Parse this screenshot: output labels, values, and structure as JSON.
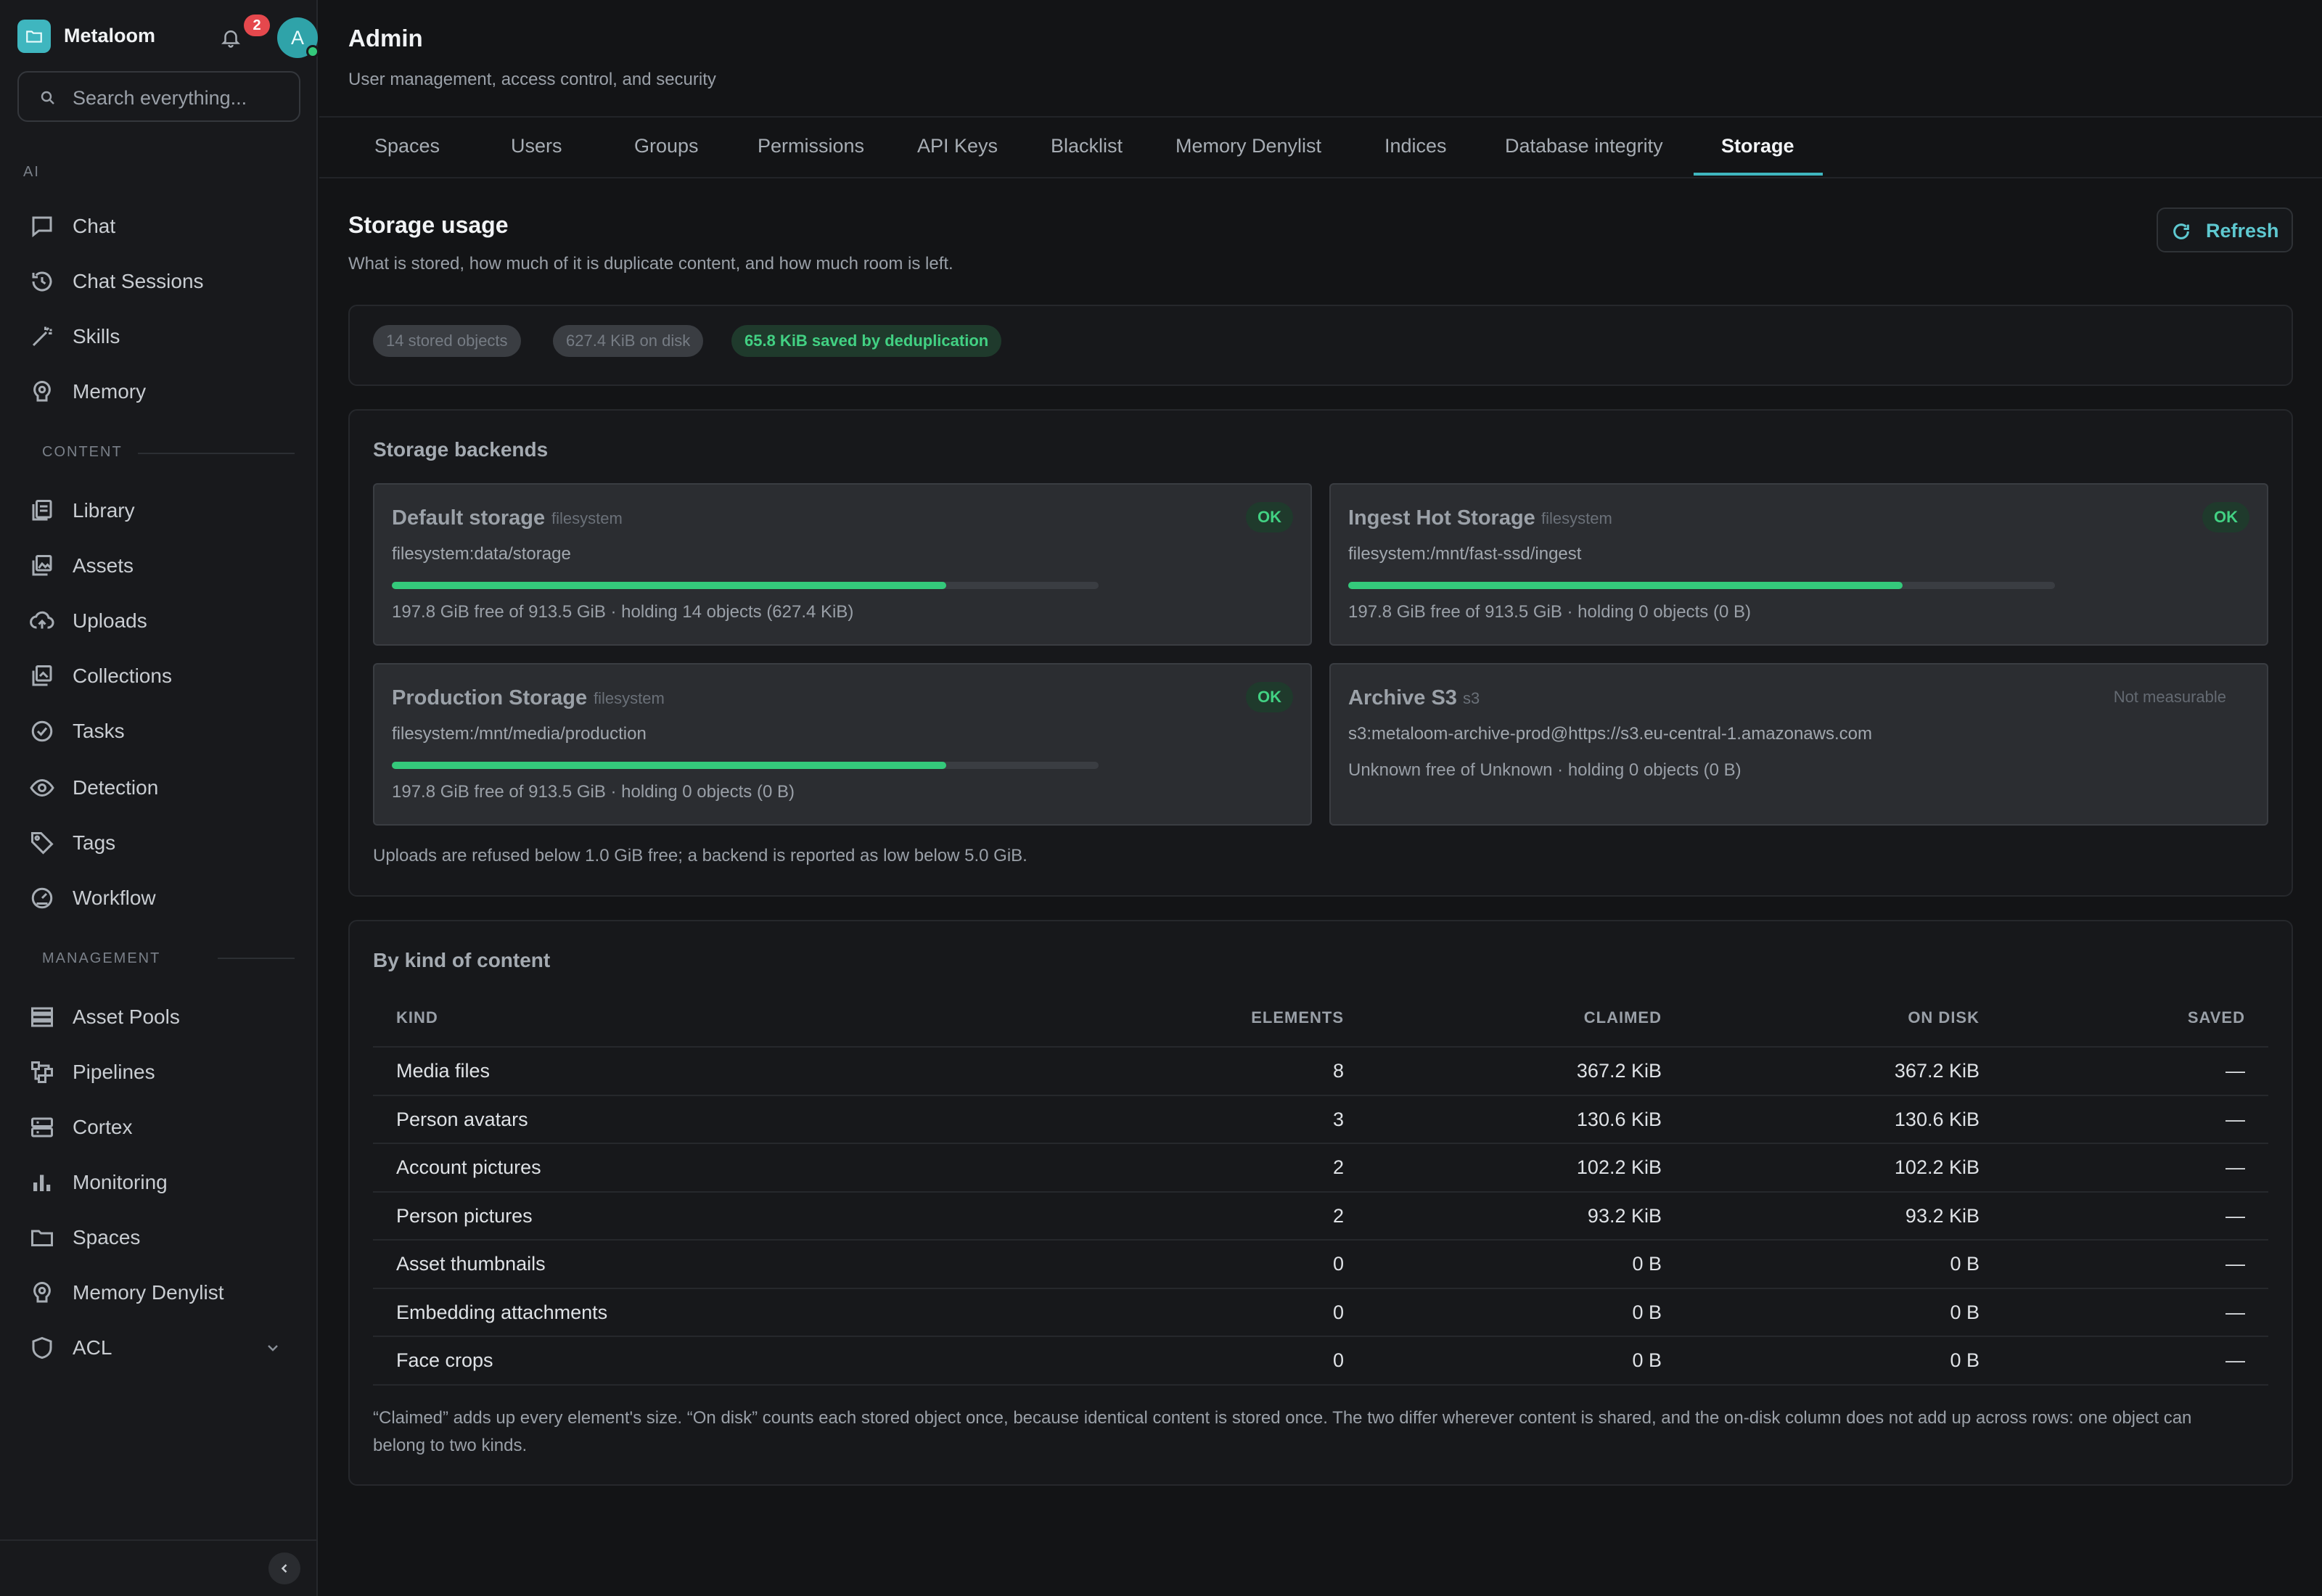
{
  "app": {
    "name": "Metaloom",
    "notification_count": "2",
    "avatar_initial": "A",
    "search_placeholder": "Search everything..."
  },
  "sidebar": {
    "sections": [
      {
        "label": "AI",
        "items": [
          "Chat",
          "Chat Sessions",
          "Skills",
          "Memory"
        ]
      },
      {
        "label": "CONTENT",
        "items": [
          "Library",
          "Assets",
          "Uploads",
          "Collections",
          "Tasks",
          "Detection",
          "Tags",
          "Workflow"
        ]
      },
      {
        "label": "MANAGEMENT",
        "items": [
          "Asset Pools",
          "Pipelines",
          "Cortex",
          "Monitoring",
          "Spaces",
          "Memory Denylist",
          "ACL"
        ]
      }
    ],
    "icons": [
      "chat-icon",
      "history-icon",
      "wand-icon",
      "brain-icon",
      "library-icon",
      "image-icon",
      "upload-icon",
      "collections-icon",
      "check-circle-icon",
      "eye-icon",
      "tag-icon",
      "gauge-icon",
      "list-icon",
      "pipeline-icon",
      "server-icon",
      "bar-chart-icon",
      "folder-icon",
      "brain-icon",
      "shield-icon"
    ]
  },
  "page": {
    "title": "Admin",
    "subtitle": "User management, access control, and security",
    "tabs": [
      "Spaces",
      "Users",
      "Groups",
      "Permissions",
      "API Keys",
      "Blacklist",
      "Memory Denylist",
      "Indices",
      "Database integrity",
      "Storage"
    ],
    "active_tab": "Storage"
  },
  "storage": {
    "title": "Storage usage",
    "subtitle": "What is stored, how much of it is duplicate content, and how much room is left.",
    "refresh_label": "Refresh",
    "chips": {
      "objects": "14 stored objects",
      "on_disk": "627.4 KiB on disk",
      "saved": "65.8 KiB saved by deduplication"
    },
    "backends_title": "Storage backends",
    "backends": [
      {
        "name": "Default storage",
        "type": "filesystem",
        "status": "OK",
        "path": "filesystem:data/storage",
        "used_fraction": 0.784,
        "info": "197.8 GiB free of 913.5 GiB · holding 14 objects (627.4 KiB)"
      },
      {
        "name": "Ingest Hot Storage",
        "type": "filesystem",
        "status": "OK",
        "path": "filesystem:/mnt/fast-ssd/ingest",
        "used_fraction": 0.784,
        "info": "197.8 GiB free of 913.5 GiB · holding 0 objects (0 B)"
      },
      {
        "name": "Production Storage",
        "type": "filesystem",
        "status": "OK",
        "path": "filesystem:/mnt/media/production",
        "used_fraction": 0.784,
        "info": "197.8 GiB free of 913.5 GiB · holding 0 objects (0 B)"
      },
      {
        "name": "Archive S3",
        "type": "s3",
        "status": "Not measurable",
        "path": "s3:metaloom-archive-prod@https://s3.eu-central-1.amazonaws.com",
        "info": "Unknown free of Unknown · holding 0 objects (0 B)"
      }
    ],
    "backends_note": "Uploads are refused below 1.0 GiB free; a backend is reported as low below 5.0 GiB.",
    "kind_title": "By kind of content",
    "table": {
      "headers": [
        "KIND",
        "ELEMENTS",
        "CLAIMED",
        "ON DISK",
        "SAVED"
      ],
      "rows": [
        [
          "Media files",
          "8",
          "367.2 KiB",
          "367.2 KiB",
          "—"
        ],
        [
          "Person avatars",
          "3",
          "130.6 KiB",
          "130.6 KiB",
          "—"
        ],
        [
          "Account pictures",
          "2",
          "102.2 KiB",
          "102.2 KiB",
          "—"
        ],
        [
          "Person pictures",
          "2",
          "93.2 KiB",
          "93.2 KiB",
          "—"
        ],
        [
          "Asset thumbnails",
          "0",
          "0 B",
          "0 B",
          "—"
        ],
        [
          "Embedding attachments",
          "0",
          "0 B",
          "0 B",
          "—"
        ],
        [
          "Face crops",
          "0",
          "0 B",
          "0 B",
          "—"
        ]
      ]
    },
    "footnote": "“Claimed” adds up every element's size. “On disk” counts each stored object once, because identical content is stored once. The two differ wherever content is shared, and the on-disk column does not add up across rows: one object can belong to two kinds."
  },
  "colors": {
    "accent": "#3fb6bf",
    "ok_green": "#34c97b",
    "badge_red": "#e5484d",
    "background": "#131416"
  }
}
